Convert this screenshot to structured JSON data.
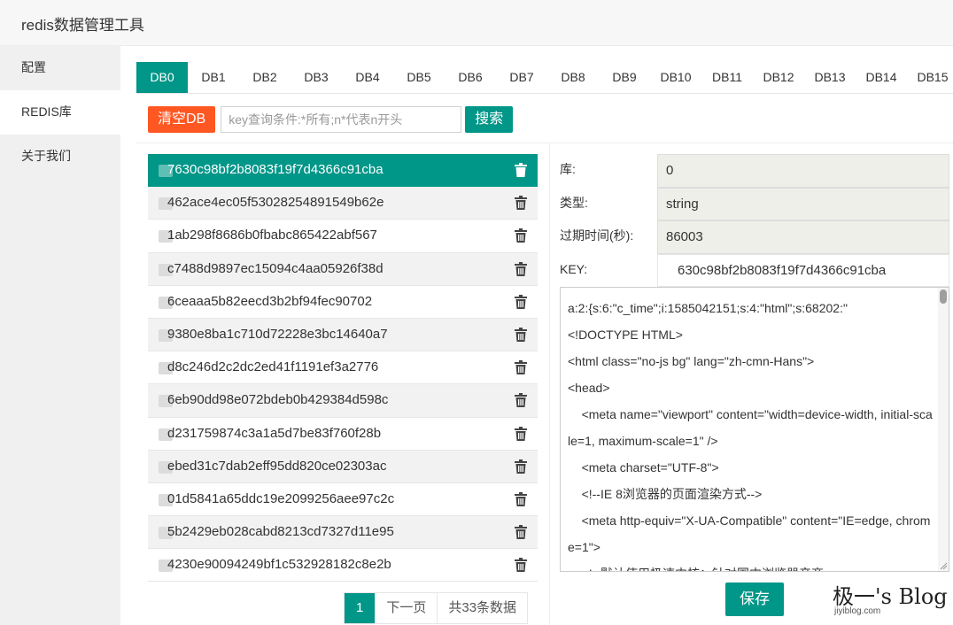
{
  "app": {
    "title": "redis数据管理工具"
  },
  "sidebar": {
    "items": [
      {
        "label": "配置",
        "active": false
      },
      {
        "label": "REDIS库",
        "active": true
      },
      {
        "label": "关于我们",
        "active": false
      }
    ]
  },
  "db_tabs": [
    "DB0",
    "DB1",
    "DB2",
    "DB3",
    "DB4",
    "DB5",
    "DB6",
    "DB7",
    "DB8",
    "DB9",
    "DB10",
    "DB11",
    "DB12",
    "DB13",
    "DB14",
    "DB15"
  ],
  "active_tab": "DB0",
  "toolbar": {
    "clear_label": "清空DB",
    "search_placeholder": "key查询条件:*所有;n*代表n开头",
    "search_value": "",
    "search_label": "搜索"
  },
  "keys": [
    "7630c98bf2b8083f19f7d4366c91cba",
    "462ace4ec05f53028254891549b62e",
    "1ab298f8686b0fbabc865422abf567",
    "c7488d9897ec15094c4aa05926f38d",
    "6ceaaa5b82eecd3b2bf94fec90702",
    "9380e8ba1c710d72228e3bc14640a7",
    "d8c246d2c2dc2ed41f1191ef3a2776",
    "6eb90dd98e072bdeb0b429384d598c",
    "d231759874c3a1a5d7be83f760f28b",
    "ebed31c7dab2eff95dd820ce02303ac",
    "01d5841a65ddc19e2099256aee97c2c",
    "5b2429eb028cabd8213cd7327d11e95",
    "4230e90094249bf1c532928182c8e2b"
  ],
  "selected_key_index": 0,
  "pagination": {
    "current": "1",
    "next_label": "下一页",
    "total_label": "共33条数据"
  },
  "detail": {
    "db_label": "库:",
    "db_value": "0",
    "type_label": "类型:",
    "type_value": "string",
    "ttl_label": "过期时间(秒):",
    "ttl_value": "86003",
    "key_label": "KEY:",
    "key_value": "630c98bf2b8083f19f7d4366c91cba",
    "value_text": "a:2:{s:6:\"c_time\";i:1585042151;s:4:\"html\";s:68202:\"\n<!DOCTYPE HTML>\n<html class=\"no-js bg\" lang=\"zh-cmn-Hans\">\n<head>\n    <meta name=\"viewport\" content=\"width=device-width, initial-scale=1, maximum-scale=1\" />\n    <meta charset=\"UTF-8\">\n    <!--IE 8浏览器的页面渲染方式-->\n    <meta http-equiv=\"X-UA-Compatible\" content=\"IE=edge, chrome=1\">\n    <!--默认使用极速内核：针对国内浏览器产商-->",
    "save_label": "保存"
  },
  "watermark": {
    "title": "极一's Blog",
    "subtitle": "jiyiblog.com"
  },
  "colors": {
    "primary": "#009688",
    "danger": "#ff5722",
    "sidebar_bg": "#f0f0f0"
  }
}
